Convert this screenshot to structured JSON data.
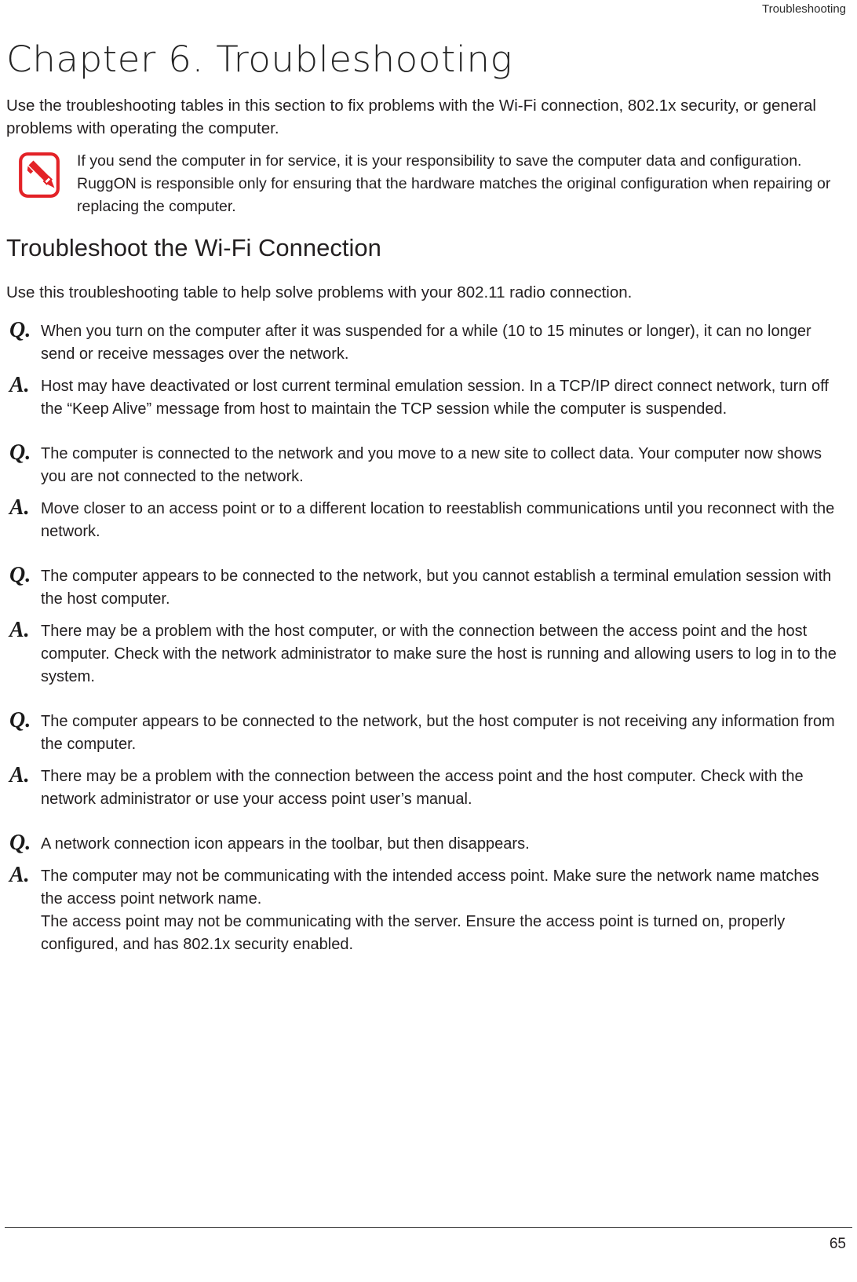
{
  "header": {
    "running_head": "Troubleshooting"
  },
  "chapter": {
    "title_prefix": "Chapter 6.",
    "title_name": "Troubleshooting",
    "title_full": "Chapter 6.  Troubleshooting"
  },
  "intro": {
    "paragraph": "Use the troubleshooting tables in this section to fix problems with the Wi-Fi connection, 802.1x security, or general problems with operating the computer."
  },
  "note": {
    "icon": "pencil-note-icon",
    "icon_color": "#e32227",
    "text": "If you send the computer in for service, it is your responsibility to save the computer data and configuration. RuggON is responsible only for ensuring that the hardware matches the original configuration when repairing or replacing the computer."
  },
  "section": {
    "heading": "Troubleshoot the Wi-Fi Connection",
    "lead": "Use this troubleshooting table to help solve problems with your 802.11 radio connection."
  },
  "qa": {
    "question_marker": "Q.",
    "answer_marker": "A.",
    "items": [
      {
        "question": "When you turn on the computer after it was suspended for a while (10 to 15 minutes or longer), it can no longer send or receive messages over the network.",
        "answer": "Host may have deactivated or lost current terminal emulation session. In a TCP/IP direct connect network, turn off the “Keep Alive” message from host to maintain the TCP session while the computer is suspended."
      },
      {
        "question": "The computer is connected to the network and you move to a new site to collect data. Your computer now shows you are not connected to the network.",
        "answer": "Move closer to an access point or to a different location to reestablish communications until you reconnect with the network."
      },
      {
        "question": "The computer appears to be connected to the network, but you cannot establish a terminal emulation session with the host computer.",
        "answer": "There may be a problem with the host computer, or with the connection between the access point and the host computer. Check with the network administrator to make sure the host is running and allowing users to log in to the system."
      },
      {
        "question": "The computer appears to be connected to the network, but the host computer is not receiving any information from the computer.",
        "answer": "There may be a problem with the connection between the access point and the host computer. Check with the network administrator or use your access point user’s manual."
      },
      {
        "question": "A network connection icon appears in the toolbar, but then disappears.",
        "answer_line_1": "The computer may not be communicating with the intended access point. Make sure the network name matches the access point network name.",
        "answer_line_2": "The access point may not be communicating with the server. Ensure the access point is turned on, properly configured, and has 802.1x security enabled."
      }
    ]
  },
  "footer": {
    "page_number": "65"
  }
}
